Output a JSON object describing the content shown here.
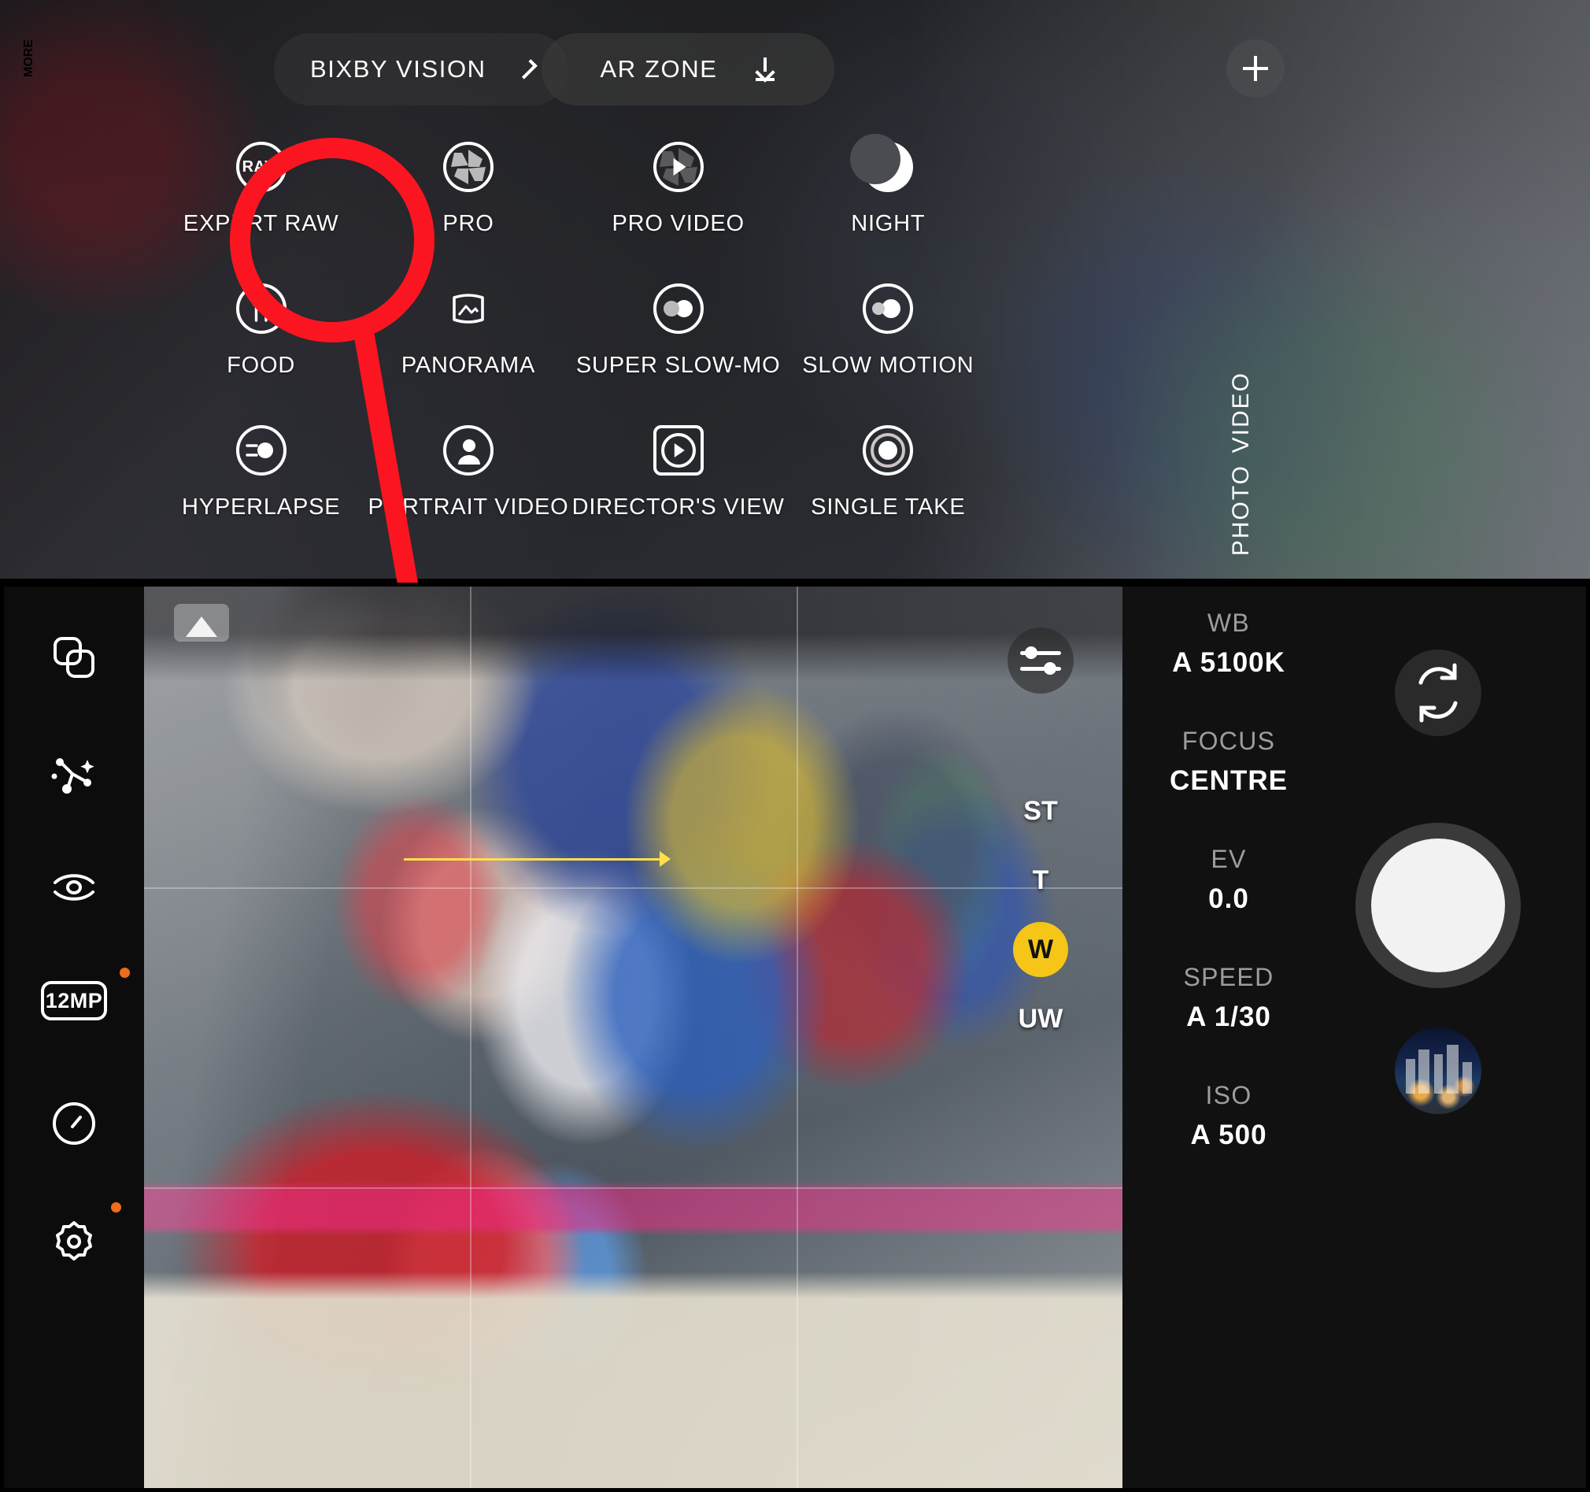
{
  "top_panel": {
    "chips": [
      {
        "id": "bixby",
        "label": "BIXBY VISION",
        "icon": "chevron-right-icon"
      },
      {
        "id": "arzone",
        "label": "AR ZONE",
        "icon": "download-icon"
      }
    ],
    "add_button": {
      "icon": "plus-icon",
      "label": "+"
    },
    "modes": [
      {
        "label": "EXPERT RAW",
        "icon": "raw-icon",
        "highlighted": true
      },
      {
        "label": "PRO",
        "icon": "aperture-icon",
        "highlighted": false
      },
      {
        "label": "PRO VIDEO",
        "icon": "aperture-play-icon",
        "highlighted": false
      },
      {
        "label": "NIGHT",
        "icon": "moon-icon",
        "highlighted": false
      },
      {
        "label": "FOOD",
        "icon": "fork-spoon-icon",
        "highlighted": false
      },
      {
        "label": "PANORAMA",
        "icon": "panorama-icon",
        "highlighted": false
      },
      {
        "label": "SUPER SLOW-MO",
        "icon": "super-slowmo-icon",
        "highlighted": false
      },
      {
        "label": "SLOW MOTION",
        "icon": "slow-motion-icon",
        "highlighted": false
      },
      {
        "label": "HYPERLAPSE",
        "icon": "hyperlapse-icon",
        "highlighted": false
      },
      {
        "label": "PORTRAIT VIDEO",
        "icon": "portrait-video-icon",
        "highlighted": false
      },
      {
        "label": "DIRECTOR'S VIEW",
        "icon": "directors-view-icon",
        "highlighted": false
      },
      {
        "label": "SINGLE TAKE",
        "icon": "single-take-icon",
        "highlighted": false
      }
    ],
    "vertical_tabs": [
      {
        "label": "MORE",
        "selected": true
      },
      {
        "label": "VIDEO",
        "selected": false
      },
      {
        "label": "PHOTO",
        "selected": false
      }
    ]
  },
  "annotation": {
    "highlight_color": "#fb1520",
    "target_mode": "EXPERT RAW"
  },
  "bottom_panel": {
    "rail_items": [
      {
        "icon": "multi-frame-icon",
        "badge": false
      },
      {
        "icon": "ai-enhance-icon",
        "badge": false
      },
      {
        "icon": "eye-detect-icon",
        "badge": false
      },
      {
        "icon": "resolution-icon",
        "label": "12MP",
        "badge": true
      },
      {
        "icon": "timer-icon",
        "badge": false
      },
      {
        "icon": "gear-icon",
        "badge": true
      }
    ],
    "viewfinder": {
      "histogram_icon": "histogram-icon",
      "adjust_icon": "sliders-icon",
      "focus_indicator": "focus-line-marker",
      "grid": "3x3"
    },
    "lens_selector": {
      "options": [
        {
          "label": "ST",
          "selected": false
        },
        {
          "label": "T",
          "selected": false
        },
        {
          "label": "W",
          "selected": true
        },
        {
          "label": "UW",
          "selected": false
        }
      ],
      "selected_color": "#f5c518"
    },
    "controls": [
      {
        "key": "WB",
        "value": "A 5100K"
      },
      {
        "key": "FOCUS",
        "value": "CENTRE"
      },
      {
        "key": "EV",
        "value": "0.0"
      },
      {
        "key": "SPEED",
        "value": "A 1/30"
      },
      {
        "key": "ISO",
        "value": "A 500"
      }
    ],
    "buttons": {
      "flip_camera": {
        "icon": "camera-flip-icon"
      },
      "shutter": {
        "icon": "shutter-button"
      },
      "gallery_thumb": {
        "icon": "gallery-thumbnail"
      }
    }
  }
}
